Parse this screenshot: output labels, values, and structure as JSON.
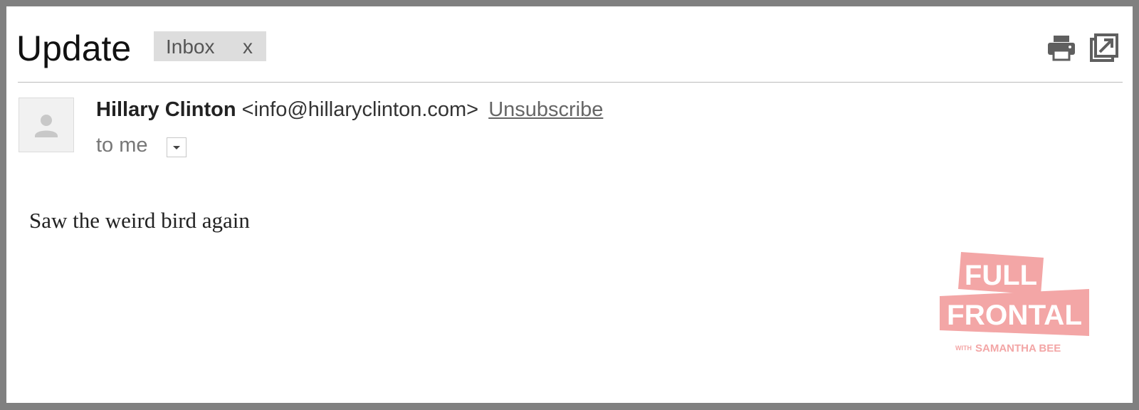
{
  "email": {
    "subject": "Update",
    "label": {
      "text": "Inbox",
      "remove": "x"
    },
    "sender": {
      "name": "Hillary Clinton",
      "email": "<info@hillaryclinton.com>",
      "unsubscribe": "Unsubscribe"
    },
    "recipient": "to me",
    "body": "Saw the weird bird again"
  },
  "toolbar": {
    "icons": [
      "print-icon",
      "popout-icon"
    ]
  },
  "watermark": {
    "line1": "FULL",
    "line2": "FRONTAL",
    "line3_small": "WITH",
    "line3": "SAMANTHA BEE",
    "color": "#f3a6a6"
  },
  "colors": {
    "frame": "#808080",
    "chip_bg": "#dddddd",
    "divider": "#bbbbbb"
  }
}
